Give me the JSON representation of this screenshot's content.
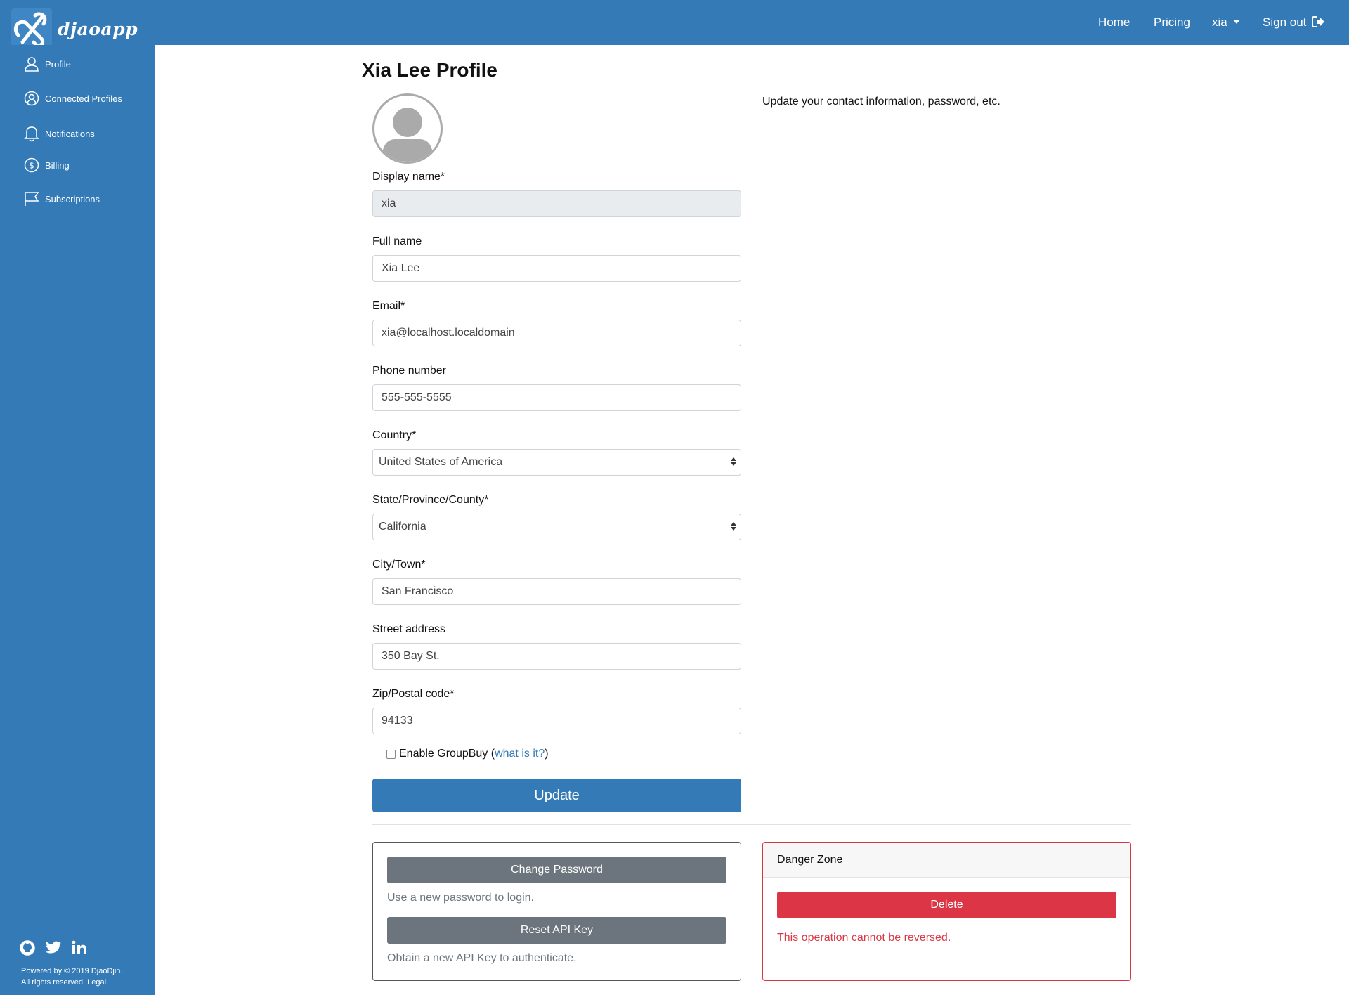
{
  "brand": {
    "name": "djaoapp"
  },
  "nav": {
    "home": "Home",
    "pricing": "Pricing",
    "user": "xia",
    "signout": "Sign out"
  },
  "sidebar": {
    "items": [
      {
        "label": "Profile",
        "icon": "user-icon"
      },
      {
        "label": "Connected Profiles",
        "icon": "user-circle-icon"
      },
      {
        "label": "Notifications",
        "icon": "bell-icon"
      },
      {
        "label": "Billing",
        "icon": "dollar-circle-icon"
      },
      {
        "label": "Subscriptions",
        "icon": "flag-icon"
      }
    ],
    "social": [
      "github-icon",
      "twitter-icon",
      "linkedin-icon"
    ],
    "footer_line1": "Powered by © 2019 DjaoDjin.",
    "footer_line2": "All rights reserved. Legal."
  },
  "page": {
    "title": "Xia Lee Profile",
    "subtitle": "Update your contact information, password, etc."
  },
  "form": {
    "display_name": {
      "label": "Display name*",
      "value": "xia"
    },
    "full_name": {
      "label": "Full name",
      "value": "Xia Lee"
    },
    "email": {
      "label": "Email*",
      "value": "xia@localhost.localdomain"
    },
    "phone": {
      "label": "Phone number",
      "value": "555-555-5555"
    },
    "country": {
      "label": "Country*",
      "value": "United States of America"
    },
    "region": {
      "label": "State/Province/County*",
      "value": "California"
    },
    "city": {
      "label": "City/Town*",
      "value": "San Francisco"
    },
    "street": {
      "label": "Street address",
      "value": "350 Bay St."
    },
    "zip": {
      "label": "Zip/Postal code*",
      "value": "94133"
    },
    "groupbuy": {
      "label": "Enable GroupBuy (",
      "link": "what is it?",
      "close": ")",
      "checked": false
    },
    "update_button": "Update"
  },
  "account_card": {
    "change_password_button": "Change Password",
    "change_password_help": "Use a new password to login.",
    "reset_api_button": "Reset API Key",
    "reset_api_help": "Obtain a new API Key to authenticate."
  },
  "danger_zone": {
    "title": "Danger Zone",
    "delete_button": "Delete",
    "warning": "This operation cannot be reversed."
  },
  "colors": {
    "primary": "#337ab7",
    "danger": "#dc3545",
    "secondary": "#6c757d"
  }
}
